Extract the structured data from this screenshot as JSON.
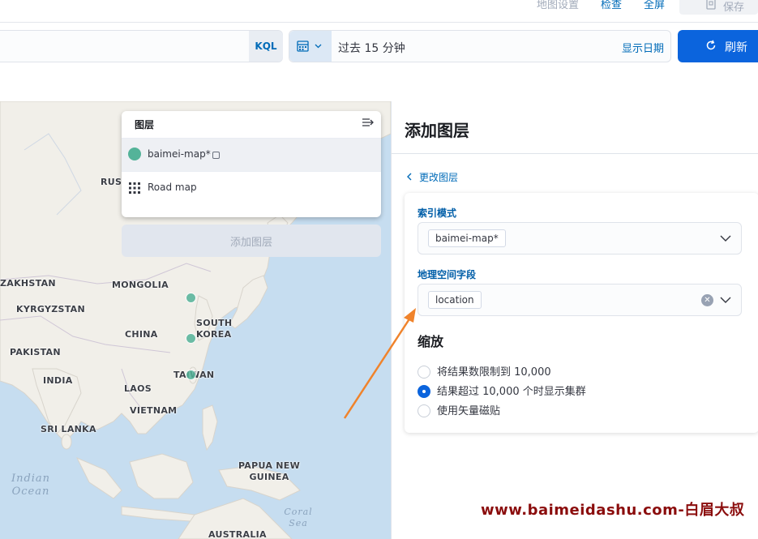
{
  "top_nav": {
    "map_settings": "地图设置",
    "inspect": "检查",
    "fullscreen": "全屏",
    "save": "保存"
  },
  "query_bar": {
    "language": "KQL",
    "time_range": "过去 15 分钟",
    "show_dates": "显示日期",
    "refresh": "刷新"
  },
  "map": {
    "labels": [
      "RUSS",
      "ZAKHSTAN",
      "MONGOLIA",
      "KYRGYZSTAN",
      "CHINA",
      "SOUTH KOREA",
      "PAKISTAN",
      "INDIA",
      "TAIWAN",
      "LAOS",
      "VIETNAM",
      "SRI LANKA",
      "PAPUA NEW GUINEA",
      "AUSTRALIA"
    ],
    "oceans": [
      "Indian Ocean",
      "Coral Sea"
    ],
    "marker_color": "#54b399"
  },
  "layer_control": {
    "title": "图层",
    "layers": [
      {
        "name": "baimei-map*",
        "icon": "circle-marker-icon",
        "selected": true
      },
      {
        "name": "Road map",
        "icon": "grid-icon",
        "selected": false
      }
    ],
    "add_layer": "添加图层"
  },
  "flyout": {
    "title": "添加图层",
    "back": "更改图层",
    "index_pattern_label": "索引模式",
    "index_pattern_value": "baimei-map*",
    "geo_field_label": "地理空间字段",
    "geo_field_value": "location",
    "scaling_title": "缩放",
    "options": [
      {
        "label": "将结果数限制到 10,000",
        "checked": false
      },
      {
        "label": "结果超过 10,000 个时显示集群",
        "checked": true
      },
      {
        "label": "使用矢量磁贴",
        "checked": false
      }
    ]
  },
  "watermark": "www.baimeidashu.com-白眉大叔",
  "colors": {
    "accent": "#0b64dd",
    "link": "#006bb8",
    "annotation_arrow": "#f0832b"
  }
}
